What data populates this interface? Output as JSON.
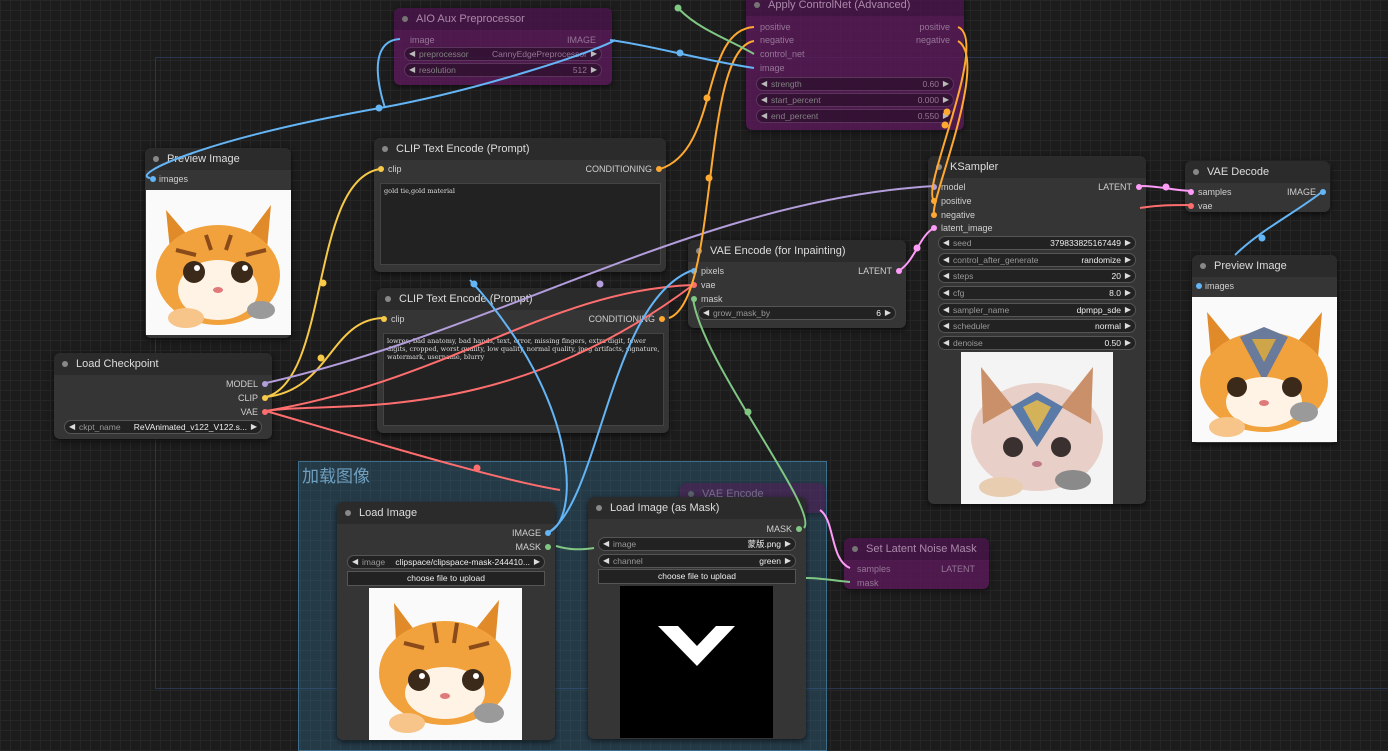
{
  "colors": {
    "clip": "#f7c948",
    "model": "#b39ddb",
    "vae": "#ff6e6e",
    "image": "#64b5f6",
    "latent": "#ff9cf9",
    "mask": "#81c784",
    "conditioning": "#ffa931"
  },
  "group": {
    "title": "加载图像"
  },
  "aio": {
    "title": "AIO Aux Preprocessor",
    "in_image": "image",
    "out_image": "IMAGE",
    "w_pre_label": "preprocessor",
    "w_pre_value": "CannyEdgePreprocessor",
    "w_res_label": "resolution",
    "w_res_value": "512"
  },
  "apply_cn": {
    "title": "Apply ControlNet (Advanced)",
    "in_positive": "positive",
    "in_negative": "negative",
    "in_control_net": "control_net",
    "in_image": "image",
    "out_positive": "positive",
    "out_negative": "negative",
    "w_strength_label": "strength",
    "w_strength_value": "0.60",
    "w_start_label": "start_percent",
    "w_start_value": "0.000",
    "w_end_label": "end_percent",
    "w_end_value": "0.550"
  },
  "preview1": {
    "title": "Preview Image",
    "in_images": "images"
  },
  "clip_pos": {
    "title": "CLIP Text Encode (Prompt)",
    "in_clip": "clip",
    "out": "CONDITIONING",
    "text": "gold tie,gold material"
  },
  "clip_neg": {
    "title": "CLIP Text Encode (Prompt)",
    "in_clip": "clip",
    "out": "CONDITIONING",
    "text": "lowres, bad anatomy, bad hands, text, error, missing fingers, extra digit, fewer digits, cropped, worst quality, low quality, normal quality, jpeg artifacts, signature, watermark, username, blurry"
  },
  "vae_encode_inpaint": {
    "title": "VAE Encode (for Inpainting)",
    "in_pixels": "pixels",
    "in_vae": "vae",
    "in_mask": "mask",
    "out": "LATENT",
    "w_grow_label": "grow_mask_by",
    "w_grow_value": "6"
  },
  "ksampler": {
    "title": "KSampler",
    "in_model": "model",
    "in_positive": "positive",
    "in_negative": "negative",
    "in_latent": "latent_image",
    "out": "LATENT",
    "widgets": [
      {
        "label": "seed",
        "value": "379833825167449"
      },
      {
        "label": "control_after_generate",
        "value": "randomize"
      },
      {
        "label": "steps",
        "value": "20"
      },
      {
        "label": "cfg",
        "value": "8.0"
      },
      {
        "label": "sampler_name",
        "value": "dpmpp_sde"
      },
      {
        "label": "scheduler",
        "value": "normal"
      },
      {
        "label": "denoise",
        "value": "0.50"
      }
    ]
  },
  "vae_decode": {
    "title": "VAE Decode",
    "in_samples": "samples",
    "in_vae": "vae",
    "out": "IMAGE"
  },
  "preview2": {
    "title": "Preview Image",
    "in_images": "images"
  },
  "checkpoint": {
    "title": "Load Checkpoint",
    "out_model": "MODEL",
    "out_clip": "CLIP",
    "out_vae": "VAE",
    "w_label": "ckpt_name",
    "w_value": "ReVAnimated_v122_V122.s..."
  },
  "load_image": {
    "title": "Load Image",
    "out_image": "IMAGE",
    "out_mask": "MASK",
    "w_label": "image",
    "w_value": "clipspace/clipspace-mask-244410...",
    "upload": "choose file to upload"
  },
  "load_mask": {
    "title": "Load Image (as Mask)",
    "out_mask": "MASK",
    "w_image_label": "image",
    "w_image_value": "蒙版.png",
    "w_channel_label": "channel",
    "w_channel_value": "green",
    "upload": "choose file to upload"
  },
  "vae_encode_bg": {
    "title": "VAE Encode"
  },
  "set_latent": {
    "title": "Set Latent Noise Mask",
    "in_samples": "samples",
    "in_mask": "mask",
    "out": "LATENT"
  }
}
